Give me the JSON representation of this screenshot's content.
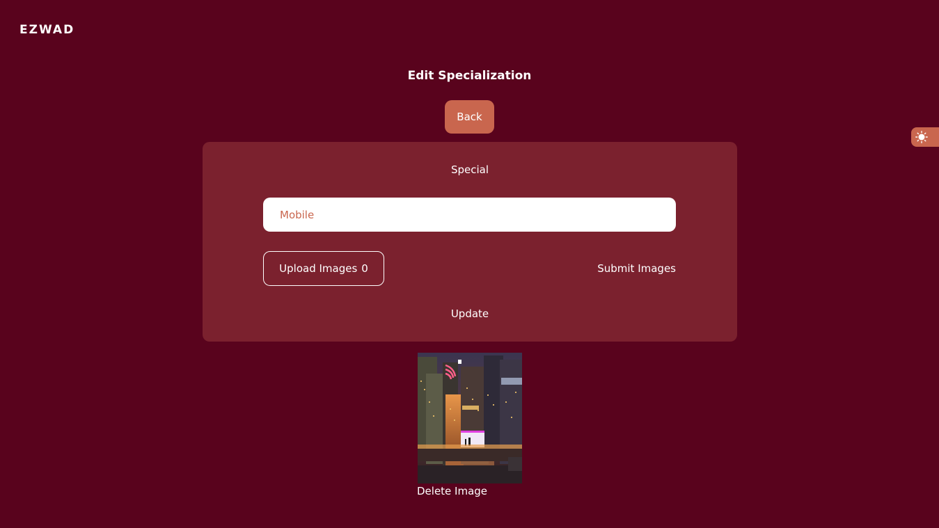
{
  "brand": {
    "logo_text": "EZWAD"
  },
  "page": {
    "title": "Edit Specialization"
  },
  "actions": {
    "back_label": "Back"
  },
  "theme_toggle": {
    "icon": "sun-icon"
  },
  "form": {
    "section_label": "Special",
    "name_input": {
      "value": "Mobile"
    },
    "upload_label": "Upload Images",
    "upload_count": "0",
    "submit_label": "Submit Images",
    "update_label": "Update"
  },
  "gallery": {
    "image_icon": "city-image",
    "delete_label": "Delete Image"
  },
  "colors": {
    "background": "#59031d",
    "card": "#7b212e",
    "accent": "#c9664e",
    "text": "#ffffff"
  }
}
